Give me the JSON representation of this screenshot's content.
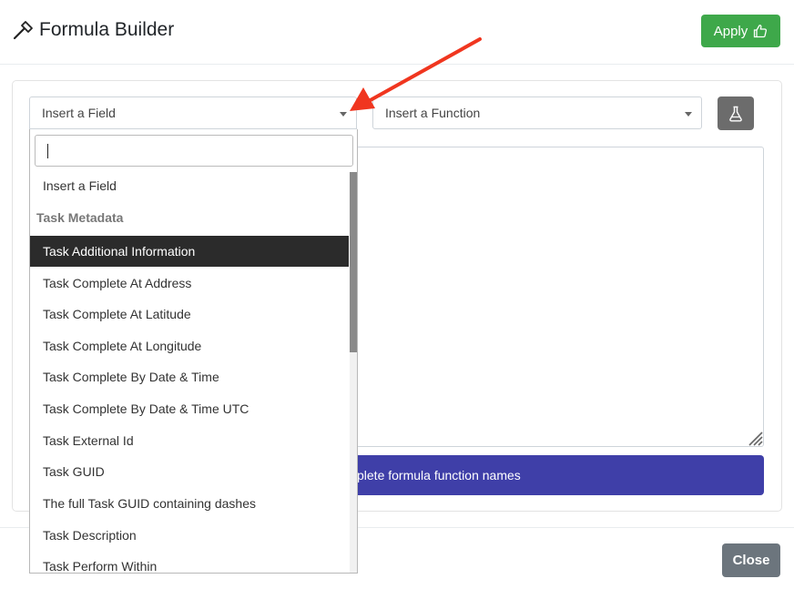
{
  "header": {
    "title": "Formula Builder",
    "apply_label": "Apply"
  },
  "field_select": {
    "label": "Insert a Field"
  },
  "function_select": {
    "label": "Insert a Function"
  },
  "banner": {
    "text": "plete formula function names"
  },
  "footer": {
    "close_label": "Close"
  },
  "dropdown": {
    "search_value": "",
    "options": [
      {
        "label": "Insert a Field"
      },
      {
        "label": "Task Metadata",
        "group": true
      },
      {
        "label": "Task Additional Information",
        "highlighted": true
      },
      {
        "label": "Task Complete At Address"
      },
      {
        "label": "Task Complete At Latitude"
      },
      {
        "label": "Task Complete At Longitude"
      },
      {
        "label": "Task Complete By Date & Time"
      },
      {
        "label": "Task Complete By Date & Time UTC"
      },
      {
        "label": "Task External Id"
      },
      {
        "label": "Task GUID"
      },
      {
        "label": "The full Task GUID containing dashes"
      },
      {
        "label": "Task Description"
      },
      {
        "label": "Task Perform Within"
      }
    ]
  },
  "colors": {
    "apply": "#3ea84a",
    "banner": "#3f3fa8",
    "highlight": "#2b2b2b",
    "arrow": "#f0361f",
    "close": "#6c757d"
  }
}
